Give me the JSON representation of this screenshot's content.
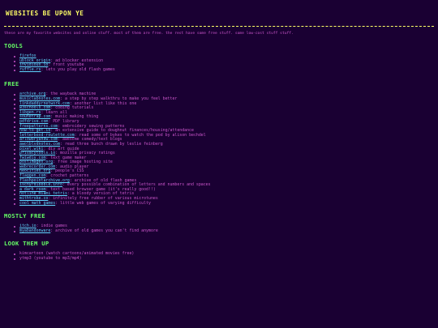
{
  "header": {
    "title": "WEBSITES BE UPON YE",
    "intro": "these are my favorite websites and online stuff. most of them are free. the rest have some free stuff. some low-cost stuff stuff."
  },
  "sections": [
    {
      "heading": "TOOLS",
      "items": [
        {
          "link": "firefox",
          "desc": ""
        },
        {
          "link": "ublock origin",
          "desc": ": ad blocker extension"
        },
        {
          "link": "invidious.io",
          "desc": ": front youtube"
        },
        {
          "link": "ruffle.rs",
          "desc": ": lets you play old flash games"
        }
      ]
    },
    {
      "heading": "FREE",
      "items": [
        {
          "link": "archive.org",
          "desc": ": the wayback machine"
        },
        {
          "link": "musiclabnotes.com",
          "desc": ": a step by step walkthru to make you feel better"
        },
        {
          "link": "linkdaddyrnetwork.com",
          "desc": ": another list like this one"
        },
        {
          "link": "w3schools.com",
          "desc": ": coding tutorials"
        },
        {
          "link": "libgen.rs",
          "desc": ": learn all"
        },
        {
          "link": "soundtrap.com",
          "desc": ": music making thing"
        },
        {
          "link": "pdfdrive.com",
          "desc": ": PDF library"
        },
        {
          "link": "freepatterns.com",
          "desc": ": embroidery sewing patterns"
        },
        {
          "link": "how-to-get.io",
          "desc": ": an extensive guide to doughnut finances/housing/attendance"
        },
        {
          "link": "letterboxd-roulette.com",
          "desc": ": read some of bykes to watch the pod by alison bechdel"
        },
        {
          "link": "arlowbryanbw.com",
          "desc": ": awesome comedy/text blogs"
        },
        {
          "link": "awolblvdnotes.com",
          "desc": ": read three bunch drawn by leslie feinberg"
        },
        {
          "link": "pixel.wiki",
          "desc": ": diy art guide"
        },
        {
          "link": "privacytools.io",
          "desc": ": mozilla privacy ratings"
        },
        {
          "link": "fwiwdiy.com",
          "desc": ": text game maker"
        },
        {
          "link": "postimages.org",
          "desc": ": free image hosting site"
        },
        {
          "link": "webrecorder.com",
          "desc": ": audio player"
        },
        {
          "link": "neocities.org",
          "desc": ": people's CSS"
        },
        {
          "link": "flaggen.com",
          "desc": ": crochet patterns"
        },
        {
          "link": "flashpointarchive.org",
          "desc": ": archive of old flash games"
        },
        {
          "link": "ischyrdibbble.info",
          "desc": ": every possible combination of letters and numbers and spaces"
        },
        {
          "link": "a dark room",
          "desc": ": text based browser game (it's really good!!)"
        },
        {
          "link": "hotline miami tetris",
          "desc": ": a bloody version of tetris"
        },
        {
          "link": "mithtroke.co",
          "desc": ": infinitely free rubber of various microtunes"
        },
        {
          "link": "cool math games",
          "desc": ": little web games of varying difficulty"
        }
      ]
    },
    {
      "heading": "MOSTLY FREE",
      "items": [
        {
          "link": "itch.io",
          "desc": ": indie games"
        },
        {
          "link": "myabandonware",
          "desc": ": archive of old games you can't find anymore"
        }
      ]
    },
    {
      "heading": "LOOK THEM UP",
      "items": [
        {
          "link": "",
          "desc": "kimcartoon (watch cartoons/animated movies free)"
        },
        {
          "link": "",
          "desc": "ytmp3 (youtube to mp3/mp4)"
        }
      ]
    }
  ],
  "colors": {
    "background": "#1a0033",
    "title": "#ffff66",
    "heading": "#66ff66",
    "text": "#cc55cc",
    "link": "#5fd7ff"
  }
}
